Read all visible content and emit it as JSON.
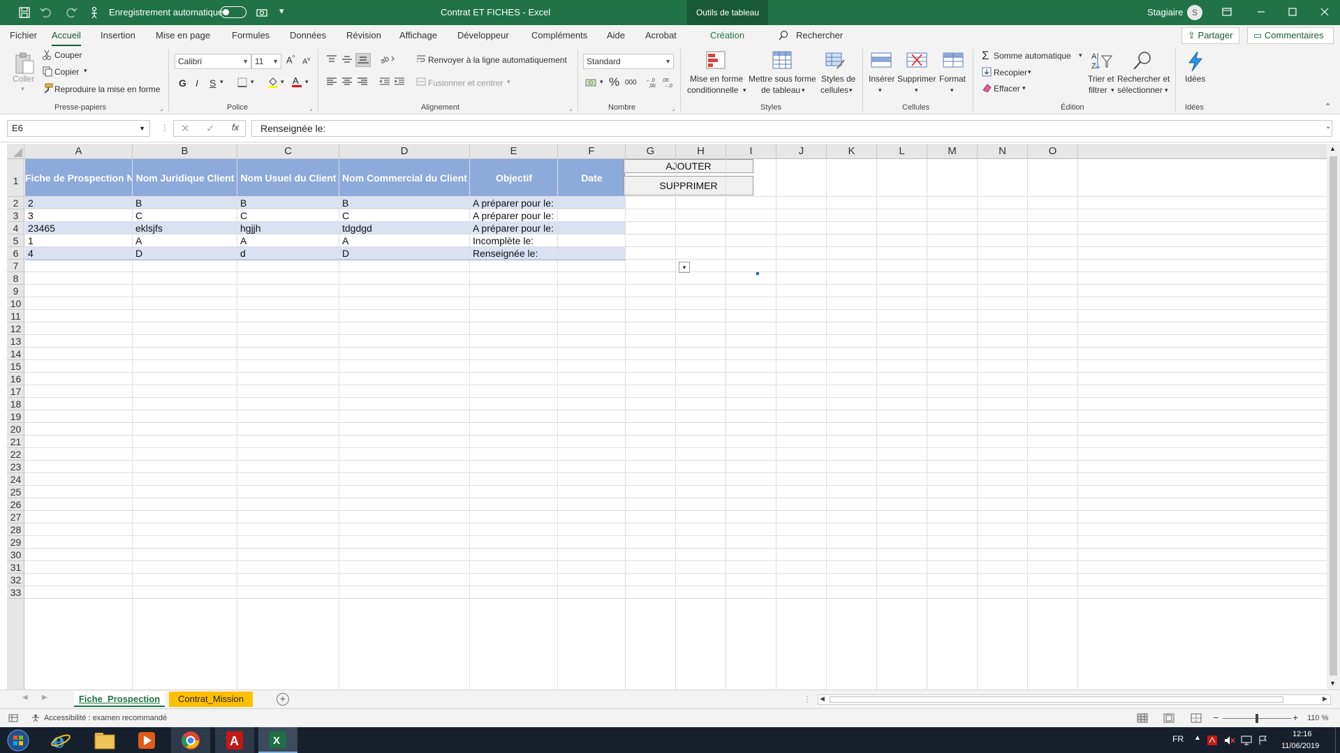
{
  "titlebar": {
    "autosave_label": "Enregistrement automatique",
    "doc_title": "Contrat ET FICHES  -  Excel",
    "tools_tab": "Outils de tableau",
    "user": "Stagiaire",
    "avatar_initial": "S"
  },
  "ribbon_tabs": [
    "Fichier",
    "Accueil",
    "Insertion",
    "Mise en page",
    "Formules",
    "Données",
    "Révision",
    "Affichage",
    "Développeur",
    "Compléments",
    "Aide",
    "Acrobat",
    "Création"
  ],
  "search_label": "Rechercher",
  "share_label": "Partager",
  "comments_label": "Commentaires",
  "ribbon": {
    "clipboard": {
      "paste": "Coller",
      "cut": "Couper",
      "copy": "Copier",
      "format_painter": "Reproduire la mise en forme",
      "group": "Presse-papiers"
    },
    "font": {
      "name": "Calibri",
      "size": "11",
      "bold": "G",
      "italic": "I",
      "underline": "S",
      "group": "Police"
    },
    "alignment": {
      "wrap": "Renvoyer à la ligne automatiquement",
      "merge": "Fusionner et centrer",
      "group": "Alignement"
    },
    "number": {
      "format": "Standard",
      "percent": "%",
      "thousands": "000",
      "group": "Nombre"
    },
    "styles": {
      "cond_line1": "Mise en forme",
      "cond_line2": "conditionnelle",
      "table_line1": "Mettre sous forme",
      "table_line2": "de tableau",
      "cell_line1": "Styles de",
      "cell_line2": "cellules",
      "group": "Styles"
    },
    "cells": {
      "insert": "Insérer",
      "delete": "Supprimer",
      "format": "Format",
      "group": "Cellules"
    },
    "editing": {
      "autosum": "Somme automatique",
      "fill": "Recopier",
      "clear": "Effacer",
      "sort_line1": "Trier et",
      "sort_line2": "filtrer",
      "find_line1": "Rechercher et",
      "find_line2": "sélectionner",
      "group": "Édition"
    },
    "ideas": {
      "label": "Idées",
      "group": "Idées"
    }
  },
  "formula_bar": {
    "name_box": "E6",
    "fx": "fx",
    "value": "Renseignée le:"
  },
  "columns": [
    "A",
    "B",
    "C",
    "D",
    "E",
    "F",
    "G",
    "H",
    "I",
    "J",
    "K",
    "L",
    "M",
    "N",
    "O"
  ],
  "rows": [
    "1",
    "2",
    "3",
    "4",
    "5",
    "6",
    "7",
    "8",
    "9",
    "10",
    "11",
    "12",
    "13",
    "14",
    "15",
    "16",
    "17",
    "18",
    "19",
    "20",
    "21",
    "22",
    "23",
    "24",
    "25",
    "26",
    "27",
    "28",
    "29",
    "30",
    "31",
    "32",
    "33"
  ],
  "table": {
    "headers": [
      "Fiche de Prospection N°",
      "Nom Juridique Client",
      "Nom Usuel du Client",
      "Nom Commercial du Client",
      "Objectif",
      "Date"
    ],
    "rows": [
      [
        "2",
        "B",
        "B",
        "B",
        "A préparer pour le:",
        ""
      ],
      [
        "3",
        "C",
        "C",
        "C",
        "A préparer pour le:",
        ""
      ],
      [
        "23465",
        "eklsjfs",
        "hgjjh",
        "tdgdgd",
        "A préparer pour le:",
        ""
      ],
      [
        "1",
        "A",
        "A",
        "A",
        "Incomplète le:",
        ""
      ],
      [
        "4",
        "D",
        "d",
        "D",
        "Renseignée le:",
        ""
      ]
    ]
  },
  "buttons": {
    "add": "AJOUTER",
    "delete": "SUPPRIMER"
  },
  "sheets": [
    "Fiche_Prospection",
    "Contrat_Mission"
  ],
  "status": {
    "accessibility": "Accessibilité : examen recommandé",
    "zoom": "110 %"
  },
  "taskbar": {
    "lang": "FR",
    "time": "12:16",
    "date": "11/06/2019"
  },
  "colors": {
    "excel_green": "#217346",
    "table_header": "#8eaadb",
    "band": "#d9e1f2",
    "sheet_tab_active": "#ffc000"
  }
}
